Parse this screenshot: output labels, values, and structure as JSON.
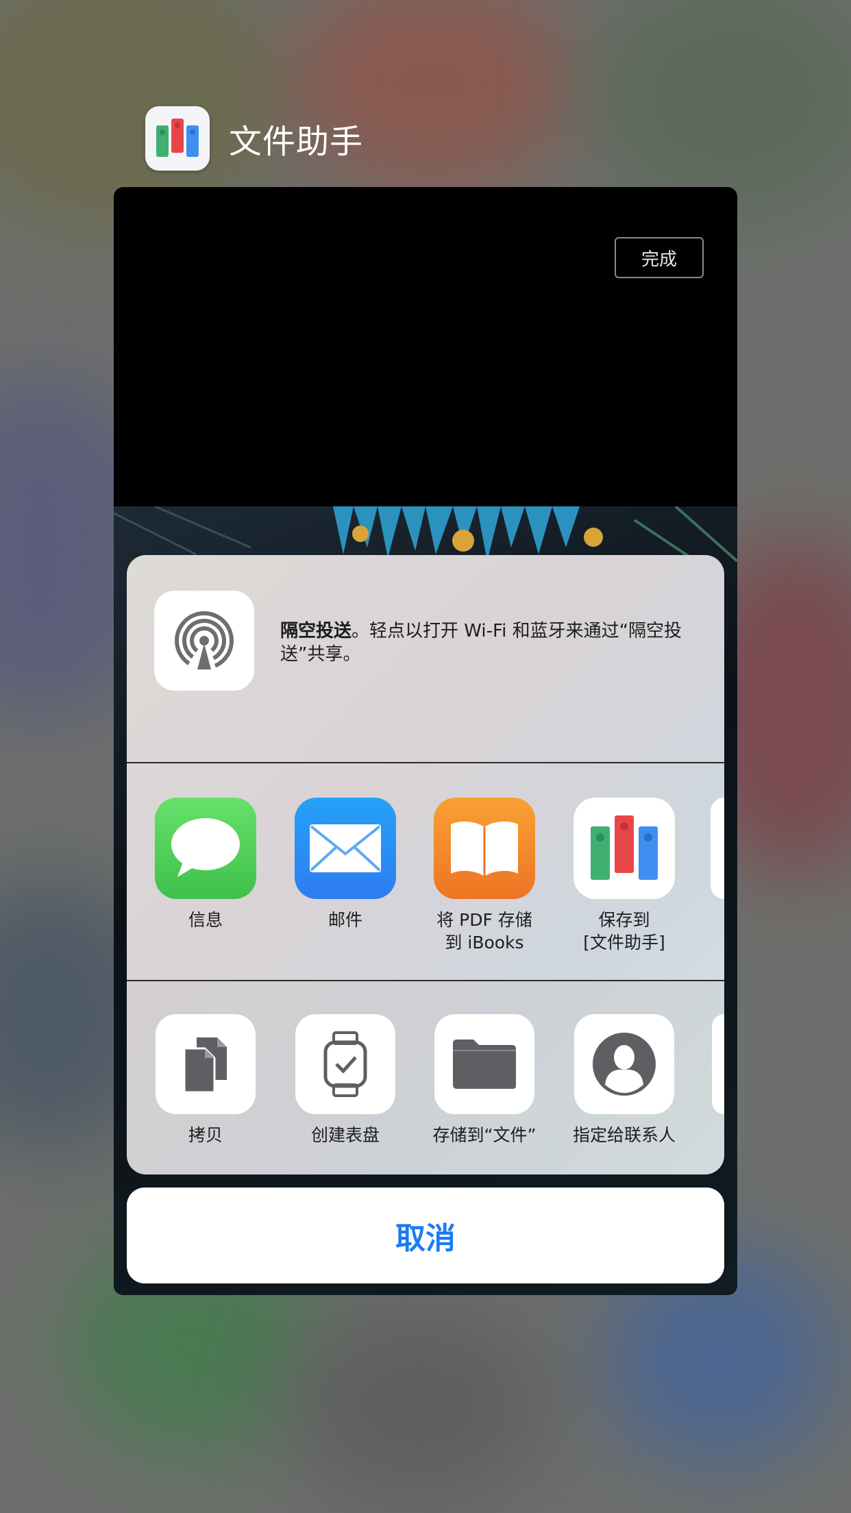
{
  "app": {
    "title": "文件助手"
  },
  "preview": {
    "done_label": "完成"
  },
  "airdrop": {
    "title": "隔空投送",
    "description": "。轻点以打开 Wi-Fi 和蓝牙来通过“隔空投送”共享。"
  },
  "share_apps": [
    {
      "label": "信息",
      "icon": "messages-icon"
    },
    {
      "label": "邮件",
      "icon": "mail-icon"
    },
    {
      "label": "将 PDF 存储\n到 iBooks",
      "icon": "ibooks-icon"
    },
    {
      "label": "保存到\n[文件助手]",
      "icon": "file-assistant-icon"
    }
  ],
  "actions": [
    {
      "label": "拷贝",
      "icon": "copy-icon"
    },
    {
      "label": "创建表盘",
      "icon": "watch-face-icon"
    },
    {
      "label": "存储到“文件”",
      "icon": "folder-icon"
    },
    {
      "label": "指定给联系人",
      "icon": "contact-icon"
    }
  ],
  "cancel_label": "取消",
  "colors": {
    "accent": "#1a7cf4",
    "messages": "#4cd964",
    "mail": "#2f8ef5",
    "ibooks": "#f3872a"
  }
}
